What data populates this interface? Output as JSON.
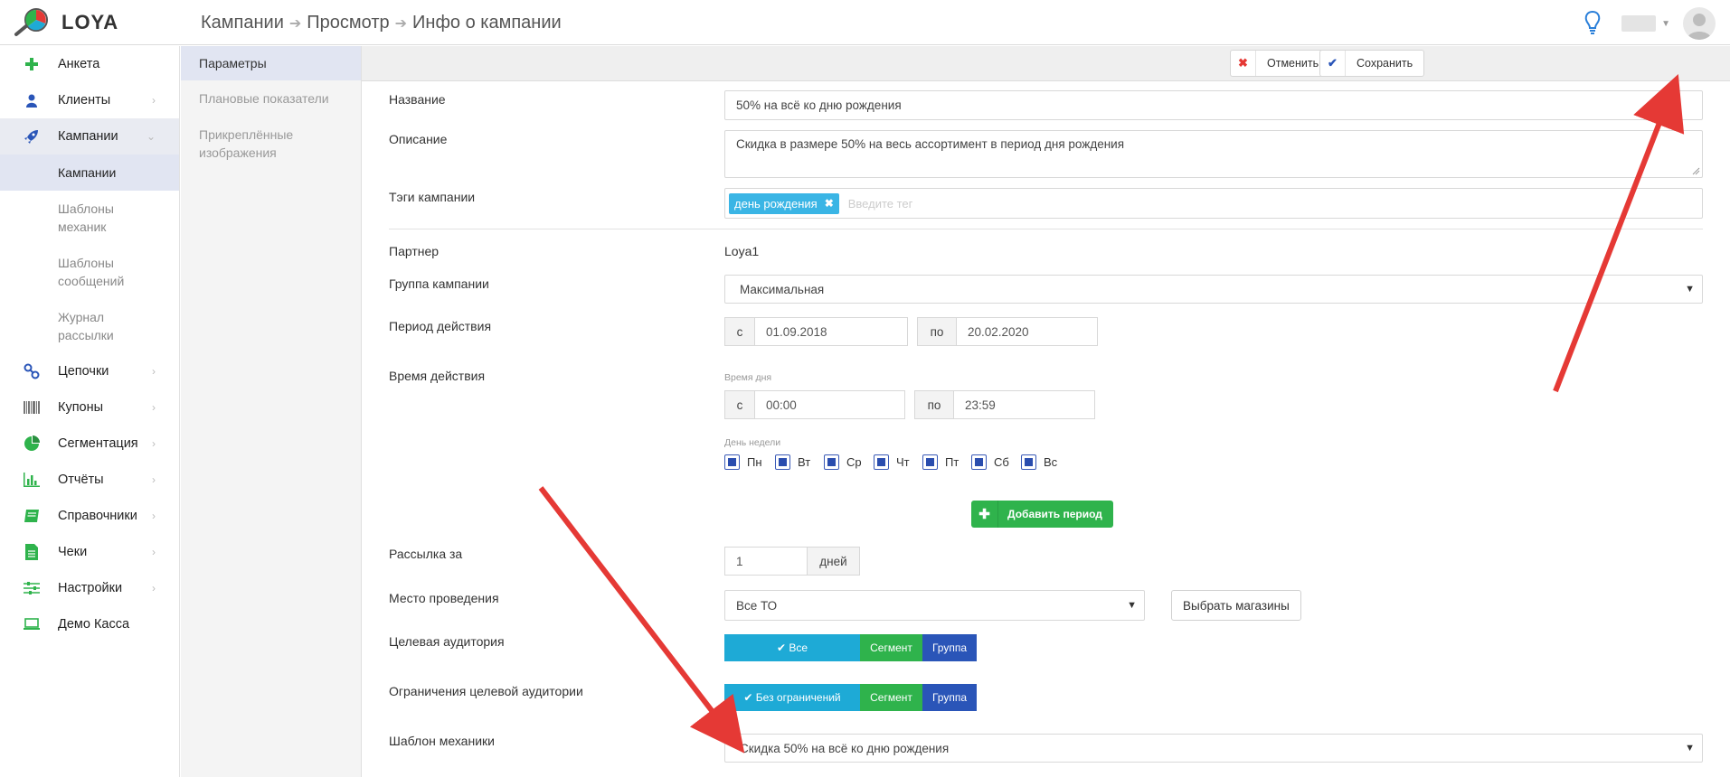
{
  "app": {
    "name": "LOYA"
  },
  "breadcrumb": [
    "Кампании",
    "Просмотр",
    "Инфо о кампании"
  ],
  "sidebar": {
    "items": [
      {
        "label": "Анкета",
        "icon": "plus-icon"
      },
      {
        "label": "Клиенты",
        "icon": "user-icon"
      },
      {
        "label": "Кампании",
        "icon": "rocket-icon"
      },
      {
        "label": "Цепочки",
        "icon": "chain-icon"
      },
      {
        "label": "Купоны",
        "icon": "barcode-icon"
      },
      {
        "label": "Сегментация",
        "icon": "pie-chart-icon"
      },
      {
        "label": "Отчёты",
        "icon": "bar-chart-icon"
      },
      {
        "label": "Справочники",
        "icon": "book-icon"
      },
      {
        "label": "Чеки",
        "icon": "receipt-icon"
      },
      {
        "label": "Настройки",
        "icon": "sliders-icon"
      },
      {
        "label": "Демо Касса",
        "icon": "laptop-icon"
      }
    ],
    "subitems": [
      "Кампании",
      "Шаблоны механик",
      "Шаблоны сообщений",
      "Журнал рассылки"
    ]
  },
  "subnav": [
    "Параметры",
    "Плановые показатели",
    "Прикреплённые изображения"
  ],
  "toolbar": {
    "cancel": "Отменить",
    "save": "Сохранить"
  },
  "form": {
    "name_label": "Название",
    "name_value": "50% на всё ко дню рождения",
    "desc_label": "Описание",
    "desc_value": "Скидка в размере 50% на весь ассортимент в период дня рождения",
    "tags_label": "Тэги кампании",
    "tag": "день рождения",
    "tag_placeholder": "Введите тег",
    "partner_label": "Партнер",
    "partner_value": "Loya1",
    "group_label": "Группа кампании",
    "group_value": "Максимальная",
    "period_label": "Период действия",
    "from": "с",
    "to": "по",
    "period_from": "01.09.2018",
    "period_to": "20.02.2020",
    "time_label": "Время действия",
    "day_time_caption": "Время дня",
    "time_from": "00:00",
    "time_to": "23:59",
    "weekday_caption": "День недели",
    "weekdays": [
      "Пн",
      "Вт",
      "Ср",
      "Чт",
      "Пт",
      "Сб",
      "Вс"
    ],
    "add_period": "Добавить период",
    "mailing_label": "Рассылка за",
    "mailing_value": "1",
    "mailing_unit": "дней",
    "place_label": "Место проведения",
    "place_value": "Все ТО",
    "choose_stores": "Выбрать магазины",
    "audience_label": "Целевая аудитория",
    "audience_options": [
      "Все",
      "Сегмент",
      "Группа"
    ],
    "limits_label": "Ограничения целевой аудитории",
    "limits_options": [
      "Без ограничений",
      "Сегмент",
      "Группа"
    ],
    "template_label": "Шаблон механики",
    "template_value": "Скидка 50% на всё ко дню рождения"
  },
  "colors": {
    "accent": "#2a55b8",
    "success": "#2fb34c",
    "info": "#1eaad6",
    "arrow": "#e53935"
  }
}
